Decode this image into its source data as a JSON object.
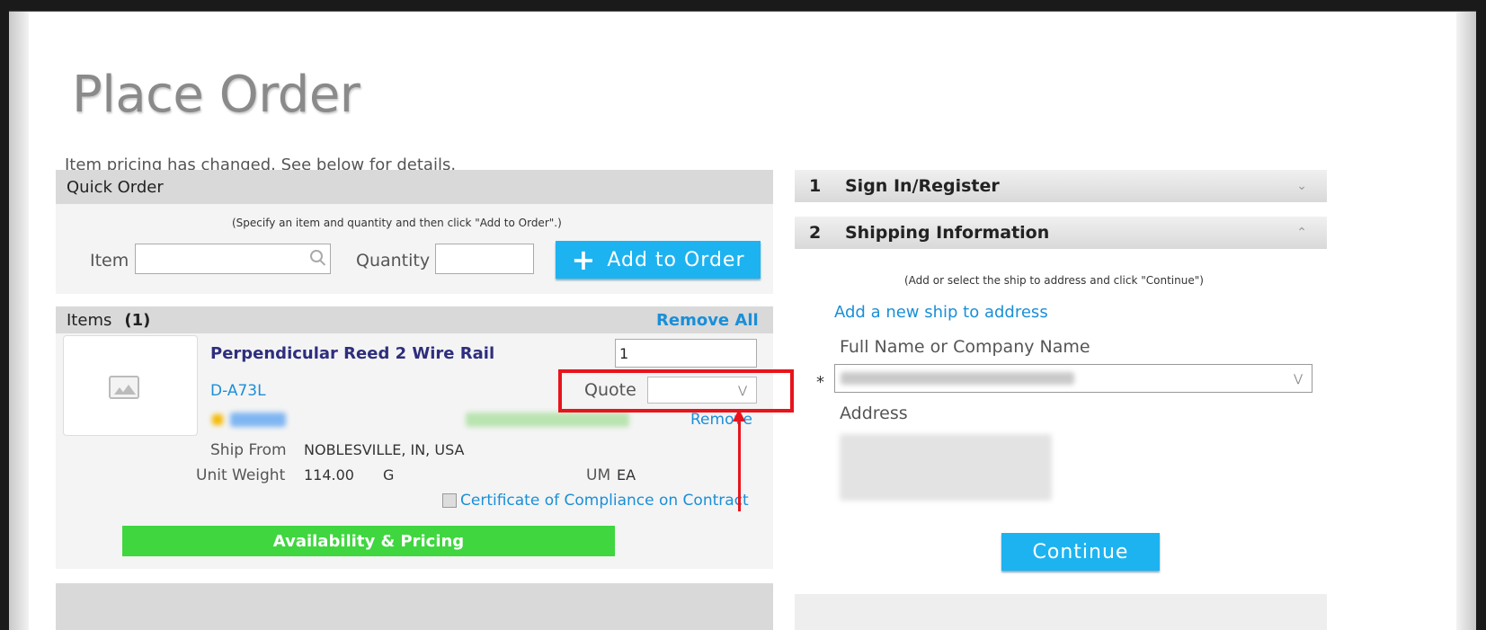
{
  "page": {
    "title": "Place Order",
    "notice": "Item pricing has changed. See below for details."
  },
  "quick_order": {
    "header": "Quick Order",
    "hint": "(Specify an item and quantity and then click \"Add to Order\".)",
    "item_label": "Item",
    "item_value": "",
    "quantity_label": "Quantity",
    "quantity_value": "",
    "add_button_label": "Add to Order"
  },
  "items": {
    "header": "Items",
    "count": "(1)",
    "remove_all": "Remove All",
    "product": {
      "name": "Perpendicular Reed 2 Wire Rail",
      "sku": "D-A73L",
      "quantity": "1",
      "quote_label": "Quote",
      "quote_value": "",
      "remove": "Remove",
      "ship_from_label": "Ship From",
      "ship_from_value": "NOBLESVILLE, IN, USA",
      "unit_weight_label": "Unit Weight",
      "unit_weight_value": "114.00",
      "unit_weight_unit": "G",
      "um_label": "UM",
      "um_value": "EA",
      "certificate_label": "Certificate of Compliance on Contract",
      "certificate_checked": false,
      "availability_button": "Availability & Pricing"
    }
  },
  "checkout": {
    "step1": {
      "number": "1",
      "label": "Sign In/Register"
    },
    "step2": {
      "number": "2",
      "label": "Shipping Information"
    },
    "hint": "(Add or select the ship to address and click \"Continue\")",
    "add_address_link": "Add a new ship to address",
    "full_name_label": "Full Name or Company Name",
    "required_mark": "*",
    "address_label": "Address",
    "continue_button": "Continue"
  },
  "colors": {
    "accent_blue": "#1db3f0",
    "link_blue": "#1a8fd8",
    "green_button": "#3fd63f",
    "annotation_red": "#e8141c"
  }
}
